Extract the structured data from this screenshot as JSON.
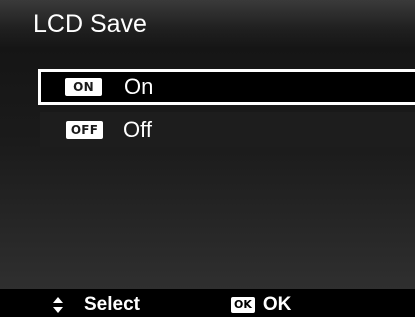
{
  "header": {
    "title": "LCD Save"
  },
  "menu": {
    "items": [
      {
        "badge": "ON",
        "label": "On",
        "selected": true
      },
      {
        "badge": "OFF",
        "label": "Off",
        "selected": false
      }
    ]
  },
  "footer": {
    "select_icon": "up-down-arrows-icon",
    "select_label": "Select",
    "ok_icon_text": "OK",
    "ok_label": "OK"
  },
  "colors": {
    "background": "#000000",
    "highlight_border": "#ffffff",
    "text": "#ffffff"
  }
}
